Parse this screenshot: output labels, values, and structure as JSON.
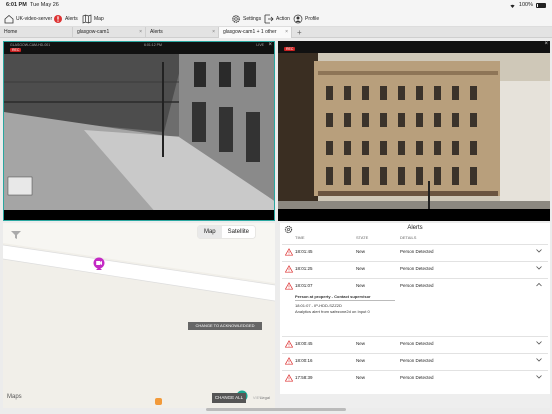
{
  "status": {
    "time": "6:01 PM",
    "date": "Tue May 26",
    "battery": "100%"
  },
  "toolbar": {
    "server": "UK-video-server",
    "alerts": "Alerts",
    "map": "Map",
    "settings": "Settings",
    "action": "Action",
    "profile": "Profile"
  },
  "tabs": [
    {
      "label": "Home"
    },
    {
      "label": "glasgow-cam1"
    },
    {
      "label": "Alerts"
    },
    {
      "label": "glasgow-cam1 + 1 other"
    }
  ],
  "cam1": {
    "rec": "REC",
    "label": "GLASGOW-CAM-HD-001",
    "timestamp": "6:01:12 PM",
    "live": "LIVE"
  },
  "cam2": {
    "rec": "REC"
  },
  "map": {
    "map_btn": "Map",
    "satellite_btn": "Satellite",
    "maps_logo": "Maps",
    "legal": "Legal"
  },
  "alerts": {
    "title": "Alerts",
    "columns": {
      "time": "TIME",
      "state": "STATE",
      "details": "DETAILS"
    },
    "rows_top": [
      {
        "time": "18:01:45",
        "state": "New",
        "details": "Person Detected"
      },
      {
        "time": "18:01:25",
        "state": "New",
        "details": "Person Detected"
      },
      {
        "time": "18:01:07",
        "state": "New",
        "details": "Person Detected"
      }
    ],
    "expanded": {
      "title": "Person at property - Contact supervisor",
      "line1": "18:01:07 - IP-HDD-SZZ2D",
      "line2": "Analytics alert from safezone2d on Input 0",
      "ack_button": "CHANGE TO ACKNOWLEDGED"
    },
    "rows_bottom": [
      {
        "time": "18:00:45",
        "state": "New",
        "details": "Person Detected"
      },
      {
        "time": "18:00:16",
        "state": "New",
        "details": "Person Detected"
      },
      {
        "time": "17:58:39",
        "state": "New",
        "details": "Person Detected"
      }
    ],
    "change_all": "CHANGE ALL",
    "view": "VIEW"
  }
}
